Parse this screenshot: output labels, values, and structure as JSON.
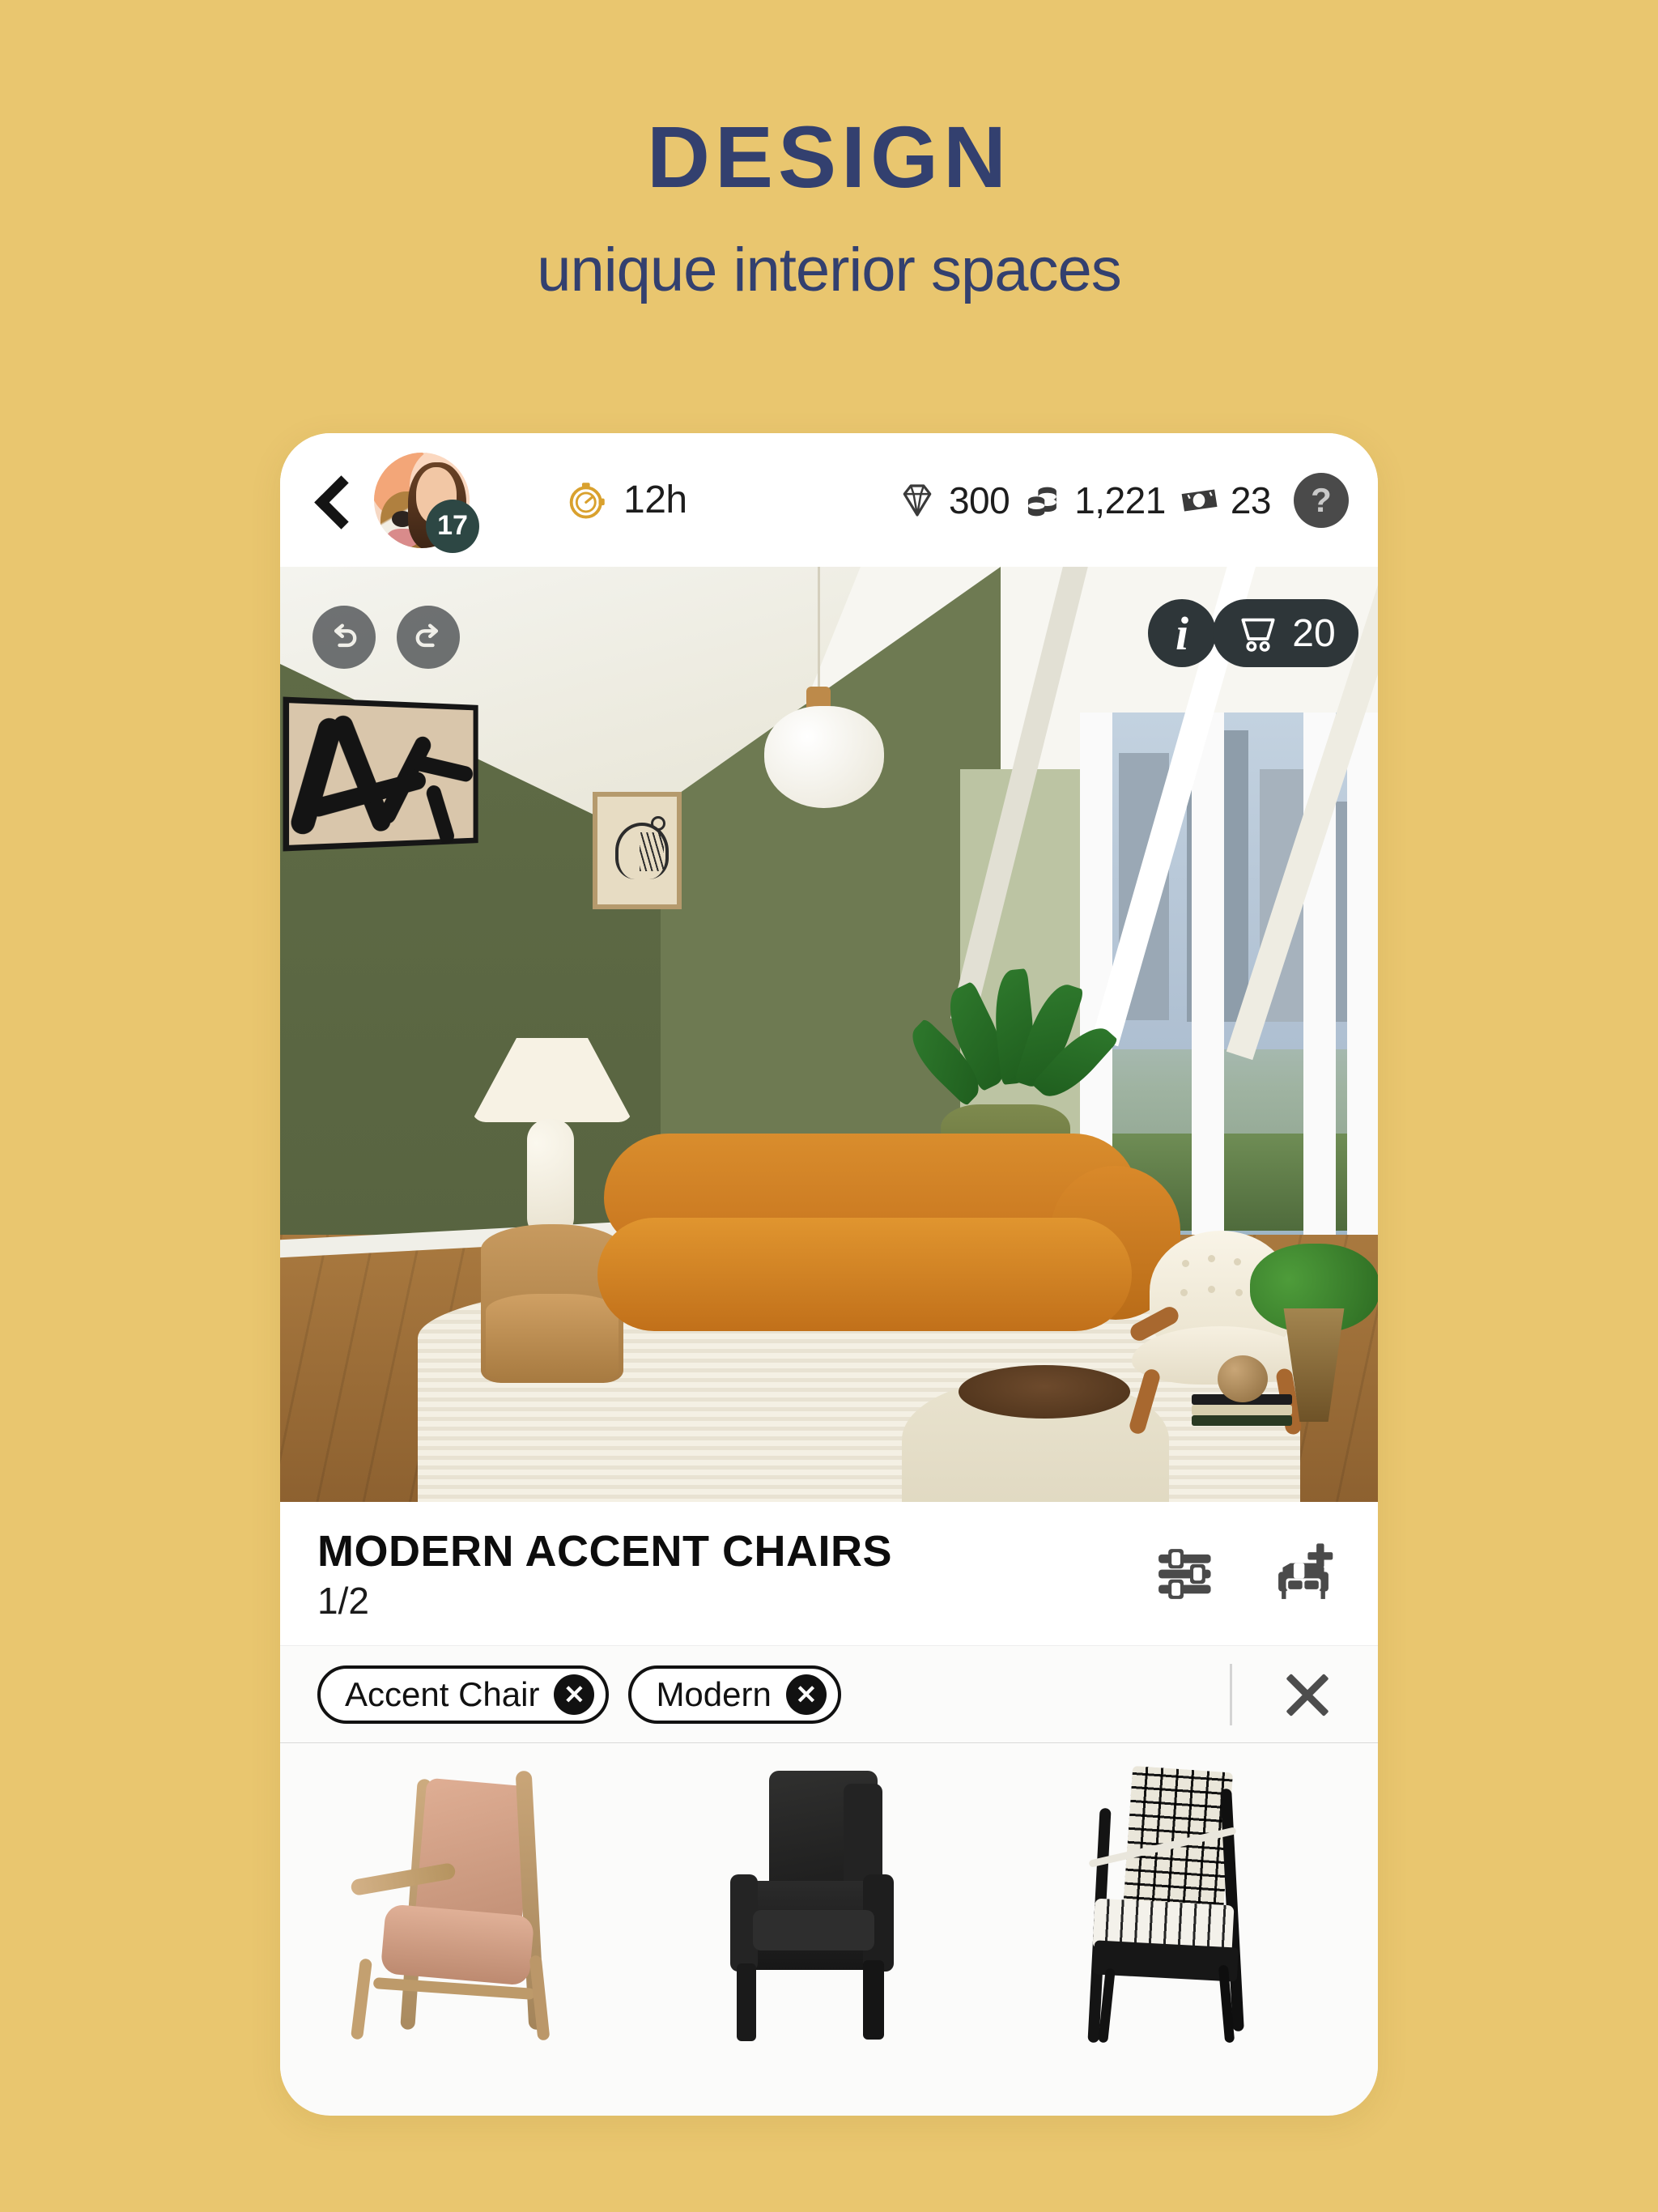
{
  "promo": {
    "title": "DESIGN",
    "subtitle": "unique interior spaces",
    "bg_color": "#e9c66f",
    "text_color": "#33406f"
  },
  "topbar": {
    "back_icon": "chevron-left-icon",
    "avatar": {
      "level_badge": "17",
      "alt": "player-avatar"
    },
    "timer": {
      "icon": "stopwatch-icon",
      "value": "12h",
      "color": "#d9a12e"
    },
    "currencies": [
      {
        "icon": "diamond-icon",
        "value": "300"
      },
      {
        "icon": "coins-icon",
        "value": "1,221"
      },
      {
        "icon": "ticket-icon",
        "value": "23"
      }
    ],
    "help_label": "?"
  },
  "room": {
    "undo_icon": "undo-arrow-icon",
    "redo_icon": "redo-arrow-icon",
    "info_label": "i",
    "cart_icon": "shopping-cart-icon",
    "cart_count": "20",
    "scene_alt": "living-room-render"
  },
  "title_row": {
    "heading": "MODERN ACCENT CHAIRS",
    "progress": "1/2",
    "filter_icon": "sliders-icon",
    "add_furniture_icon": "add-sofa-icon"
  },
  "filters": {
    "chips": [
      {
        "label": "Accent Chair",
        "remove_label": "✕"
      },
      {
        "label": "Modern",
        "remove_label": "✕"
      }
    ],
    "clear_all_icon": "close-x-icon"
  },
  "shelf": {
    "items": [
      {
        "name": "tan-leather-wood-lounge-chair"
      },
      {
        "name": "black-upholstered-armchair"
      },
      {
        "name": "black-frame-woven-chair"
      }
    ]
  },
  "colors": {
    "background": "#e9c66f",
    "navy": "#33406f",
    "card": "#fbfbfa",
    "dark_pill": "#2e3639",
    "badge_green": "#2d4744",
    "wall_green": "#5f6b46",
    "sofa_tan": "#d98d2d"
  }
}
